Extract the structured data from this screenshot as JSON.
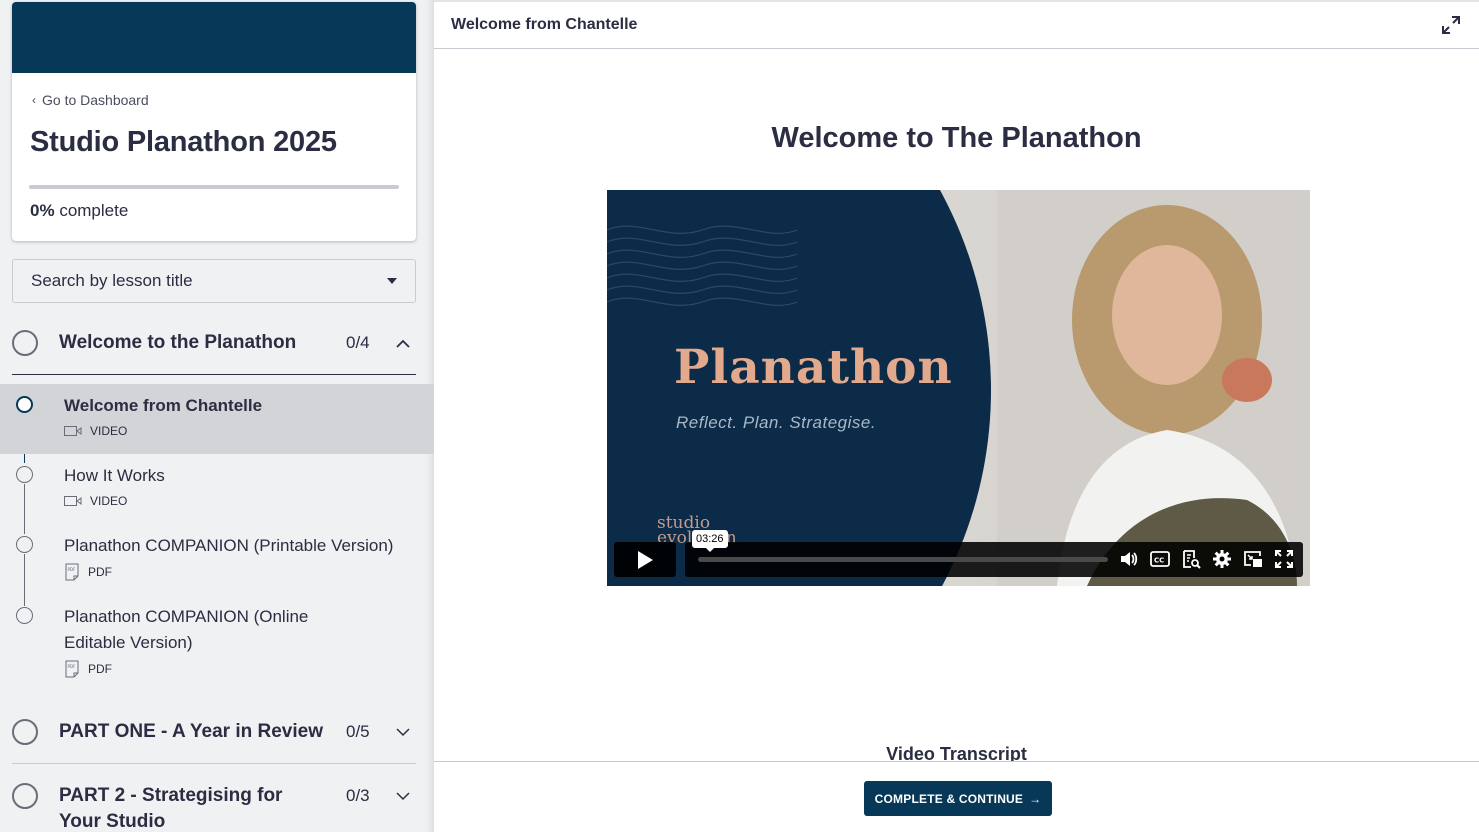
{
  "sidebar": {
    "back_link": "Go to Dashboard",
    "course_title": "Studio Planathon 2025",
    "progress": {
      "percent": 0,
      "percent_label": "0%",
      "suffix": "complete"
    },
    "search_placeholder": "Search by lesson title",
    "chapters": [
      {
        "title": "Welcome to the Planathon",
        "count": "0/4",
        "expanded": true,
        "lessons": [
          {
            "title": "Welcome from Chantelle",
            "type": "VIDEO",
            "icon": "video-icon",
            "active": true
          },
          {
            "title": "How It Works",
            "type": "VIDEO",
            "icon": "video-icon",
            "active": false
          },
          {
            "title": "Planathon COMPANION (Printable Version)",
            "type": "PDF",
            "icon": "pdf-icon",
            "active": false
          },
          {
            "title": "Planathon COMPANION (Online Editable Version)",
            "type": "PDF",
            "icon": "pdf-icon",
            "active": false
          }
        ]
      },
      {
        "title": "PART ONE - A Year in Review",
        "count": "0/5",
        "expanded": false
      },
      {
        "title": "PART 2 - Strategising for Your Studio",
        "count": "0/3",
        "expanded": false
      }
    ]
  },
  "main": {
    "header_title": "Welcome from Chantelle",
    "lesson_heading": "Welcome to The Planathon",
    "video": {
      "brand": "Planathon",
      "tagline": "Reflect. Plan. Strategise.",
      "logo_line1": "studio",
      "logo_line2": "evolution",
      "time_tooltip": "03:26",
      "controls": [
        "volume-icon",
        "captions-icon",
        "transcript-search-icon",
        "settings-icon",
        "picture-in-picture-icon",
        "fullscreen-icon"
      ]
    },
    "transcript_heading": "Video Transcript",
    "complete_button": "COMPLETE & CONTINUE",
    "complete_arrow": "→"
  },
  "colors": {
    "brand_navy": "#073857",
    "text": "#2b2d42",
    "sidebar_bg": "#f0f1f3",
    "active_lesson_bg": "#d3d4d8",
    "video_accent": "#e3a98d"
  }
}
